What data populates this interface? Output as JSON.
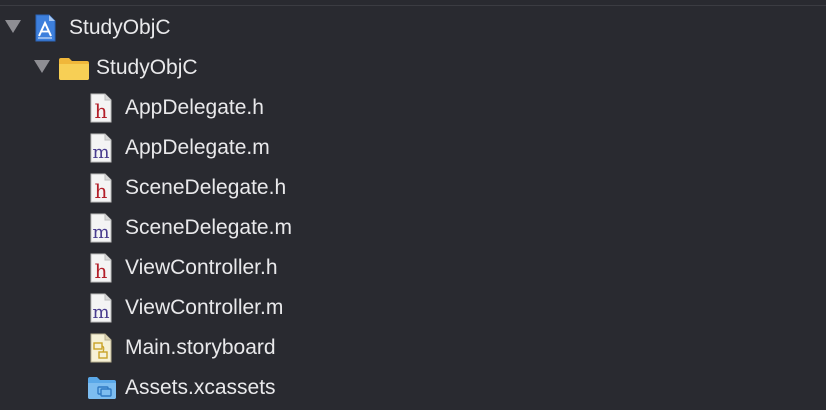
{
  "navigator": {
    "project": {
      "name": "StudyObjC",
      "icon": "xcode-project-icon"
    },
    "group": {
      "name": "StudyObjC",
      "icon": "folder-icon"
    },
    "files": [
      {
        "name": "AppDelegate.h",
        "icon": "header-file-icon",
        "glyph": "h",
        "glyph_color": "#b3202a"
      },
      {
        "name": "AppDelegate.m",
        "icon": "objc-source-file-icon",
        "glyph": "m",
        "glyph_color": "#4a3d8f"
      },
      {
        "name": "SceneDelegate.h",
        "icon": "header-file-icon",
        "glyph": "h",
        "glyph_color": "#b3202a"
      },
      {
        "name": "SceneDelegate.m",
        "icon": "objc-source-file-icon",
        "glyph": "m",
        "glyph_color": "#4a3d8f"
      },
      {
        "name": "ViewController.h",
        "icon": "header-file-icon",
        "glyph": "h",
        "glyph_color": "#b3202a"
      },
      {
        "name": "ViewController.m",
        "icon": "objc-source-file-icon",
        "glyph": "m",
        "glyph_color": "#4a3d8f"
      },
      {
        "name": "Main.storyboard",
        "icon": "storyboard-file-icon"
      },
      {
        "name": "Assets.xcassets",
        "icon": "asset-catalog-icon"
      }
    ]
  }
}
